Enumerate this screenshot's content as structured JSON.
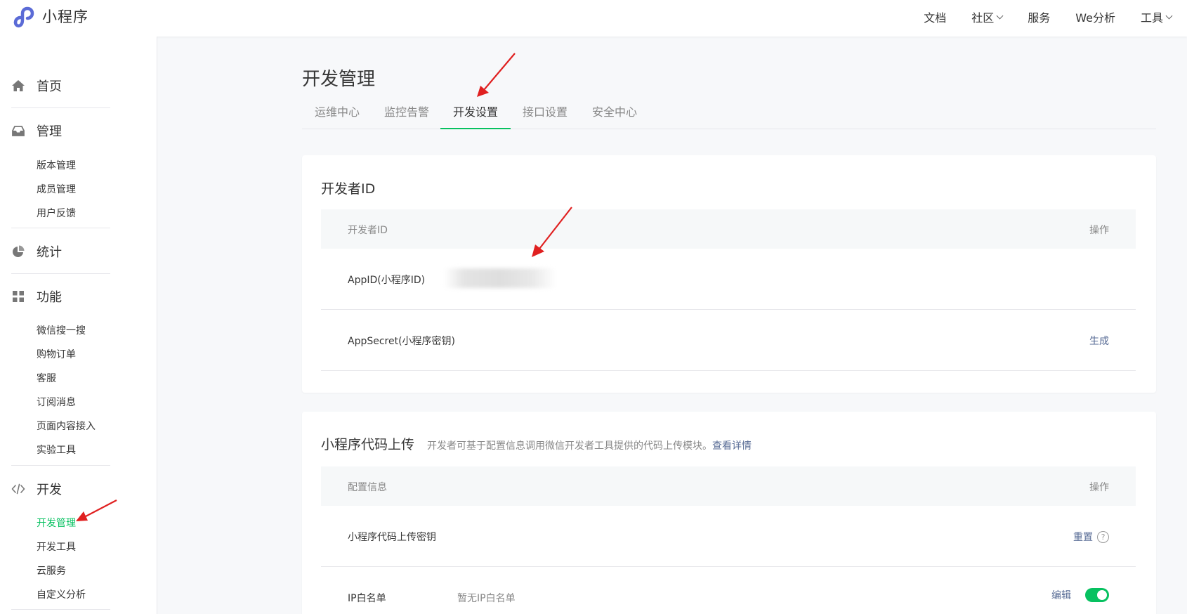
{
  "header": {
    "app_name": "小程序",
    "nav": [
      "文档",
      "社区",
      "服务",
      "We分析",
      "工具"
    ]
  },
  "sidebar": {
    "home": "首页",
    "manage": {
      "label": "管理",
      "items": [
        "版本管理",
        "成员管理",
        "用户反馈"
      ]
    },
    "stats": "统计",
    "features": {
      "label": "功能",
      "items": [
        "微信搜一搜",
        "购物订单",
        "客服",
        "订阅消息",
        "页面内容接入",
        "实验工具"
      ]
    },
    "develop": {
      "label": "开发",
      "items": [
        "开发管理",
        "开发工具",
        "云服务",
        "自定义分析"
      ]
    }
  },
  "main": {
    "title": "开发管理",
    "tabs": [
      "运维中心",
      "监控告警",
      "开发设置",
      "接口设置",
      "安全中心"
    ],
    "active_tab": "开发设置",
    "dev_id_card": {
      "title": "开发者ID",
      "col_left": "开发者ID",
      "col_right": "操作",
      "rows": [
        {
          "label": "AppID(小程序ID)",
          "value": "",
          "action": ""
        },
        {
          "label": "AppSecret(小程序密钥)",
          "value": "",
          "action": "生成"
        }
      ]
    },
    "upload_card": {
      "title": "小程序代码上传",
      "desc": "开发者可基于配置信息调用微信开发者工具提供的代码上传模块。",
      "desc_link": "查看详情",
      "col_left": "配置信息",
      "col_right": "操作",
      "rows": [
        {
          "label": "小程序代码上传密钥",
          "value": "",
          "action": "重置"
        },
        {
          "label": "IP白名单",
          "value": "暂无IP白名单",
          "action": "编辑"
        }
      ]
    }
  },
  "colors": {
    "accent": "#07c160",
    "link": "#576b95",
    "annotation": "#e02020"
  }
}
